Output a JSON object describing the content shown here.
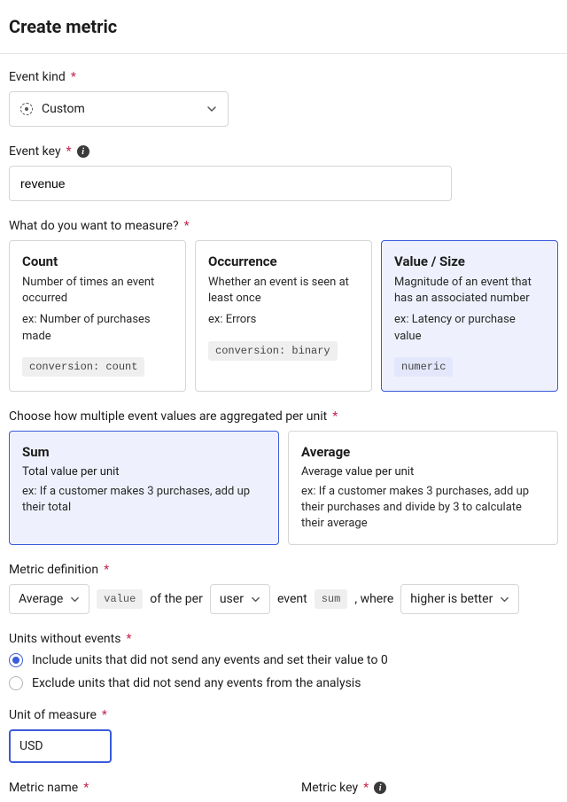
{
  "title": "Create metric",
  "event_kind": {
    "label": "Event kind",
    "value": "Custom"
  },
  "event_key": {
    "label": "Event key",
    "value": "revenue"
  },
  "measure": {
    "label": "What do you want to measure?",
    "options": [
      {
        "title": "Count",
        "desc": "Number of times an event occurred",
        "example": "ex: Number of purchases made",
        "chip": "conversion: count"
      },
      {
        "title": "Occurrence",
        "desc": "Whether an event is seen at least once",
        "example": "ex: Errors",
        "chip": "conversion: binary"
      },
      {
        "title": "Value / Size",
        "desc": "Magnitude of an event that has an associated number",
        "example": "ex: Latency or purchase value",
        "chip": "numeric"
      }
    ],
    "selected": 2
  },
  "aggregation": {
    "label": "Choose how multiple event values are aggregated per unit",
    "options": [
      {
        "title": "Sum",
        "desc": "Total value per unit",
        "example": "ex: If a customer makes 3 purchases, add up their total"
      },
      {
        "title": "Average",
        "desc": "Average value per unit",
        "example": "ex: If a customer makes 3 purchases, add up their purchases and divide by 3 to calculate their average"
      }
    ],
    "selected": 0
  },
  "definition": {
    "label": "Metric definition",
    "agg": "Average",
    "chip1": "value",
    "mid1": "of the per",
    "unit": "user",
    "mid2": "event",
    "chip2": "sum",
    "mid3": ", where",
    "criterion": "higher is better"
  },
  "units_without": {
    "label": "Units without events",
    "options": [
      "Include units that did not send any events and set their value to 0",
      "Exclude units that did not send any events from the analysis"
    ],
    "selected": 0
  },
  "unit_measure": {
    "label": "Unit of measure",
    "value": "USD"
  },
  "metric_name": {
    "label": "Metric name"
  },
  "metric_key": {
    "label": "Metric key"
  }
}
